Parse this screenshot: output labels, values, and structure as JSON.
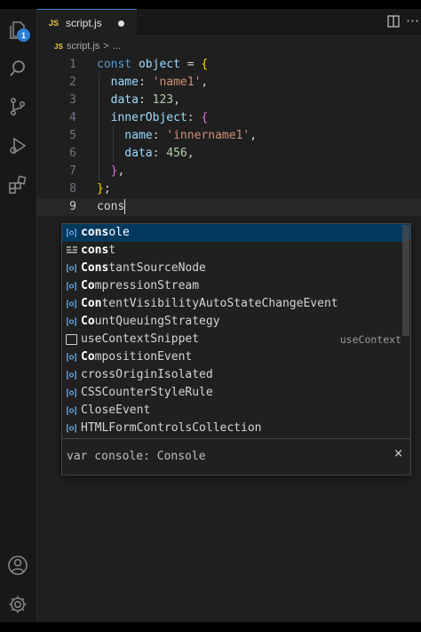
{
  "tab": {
    "badge": "JS",
    "title": "script.js"
  },
  "breadcrumb": {
    "badge": "JS",
    "file": "script.js",
    "separator": ">",
    "more": "..."
  },
  "activity": {
    "explorer_badge": "1"
  },
  "lines": [
    {
      "n": "1",
      "tokens": [
        {
          "t": "const ",
          "c": "kw"
        },
        {
          "t": "object",
          "c": "var"
        },
        {
          "t": " = ",
          "c": "punc"
        },
        {
          "t": "{",
          "c": "br2"
        }
      ]
    },
    {
      "n": "2",
      "tokens": [
        {
          "t": "  name",
          "c": "prop"
        },
        {
          "t": ": ",
          "c": "punc"
        },
        {
          "t": "'name1'",
          "c": "str"
        },
        {
          "t": ",",
          "c": "punc"
        }
      ]
    },
    {
      "n": "3",
      "tokens": [
        {
          "t": "  data",
          "c": "prop"
        },
        {
          "t": ": ",
          "c": "punc"
        },
        {
          "t": "123",
          "c": "num"
        },
        {
          "t": ",",
          "c": "punc"
        }
      ]
    },
    {
      "n": "4",
      "tokens": [
        {
          "t": "  innerObject",
          "c": "prop"
        },
        {
          "t": ": ",
          "c": "punc"
        },
        {
          "t": "{",
          "c": "br"
        }
      ]
    },
    {
      "n": "5",
      "tokens": [
        {
          "t": "    name",
          "c": "prop"
        },
        {
          "t": ": ",
          "c": "punc"
        },
        {
          "t": "'innername1'",
          "c": "str"
        },
        {
          "t": ",",
          "c": "punc"
        }
      ]
    },
    {
      "n": "6",
      "tokens": [
        {
          "t": "    data",
          "c": "prop"
        },
        {
          "t": ": ",
          "c": "punc"
        },
        {
          "t": "456",
          "c": "num"
        },
        {
          "t": ",",
          "c": "punc"
        }
      ]
    },
    {
      "n": "7",
      "tokens": [
        {
          "t": "  ",
          "c": "punc"
        },
        {
          "t": "}",
          "c": "br"
        },
        {
          "t": ",",
          "c": "punc"
        }
      ]
    },
    {
      "n": "8",
      "tokens": [
        {
          "t": "}",
          "c": "br2"
        },
        {
          "t": ";",
          "c": "punc"
        }
      ]
    },
    {
      "n": "9",
      "tokens": [
        {
          "t": "cons",
          "c": "punc"
        }
      ]
    }
  ],
  "suggestions": [
    {
      "match": "cons",
      "rest": "ole",
      "icon": "variable-icon",
      "detail": ""
    },
    {
      "match": "cons",
      "rest": "t",
      "icon": "keyword-icon",
      "detail": ""
    },
    {
      "match": "Cons",
      "rest": "tantSourceNode",
      "icon": "variable-icon",
      "detail": ""
    },
    {
      "match": "Co",
      "rest": "mpressionStream",
      "icon": "variable-icon",
      "detail": ""
    },
    {
      "match": "Con",
      "rest": "tentVisibilityAutoStateChangeEvent",
      "icon": "variable-icon",
      "detail": ""
    },
    {
      "match": "Co",
      "rest": "untQueuingStrategy",
      "icon": "variable-icon",
      "detail": ""
    },
    {
      "match": "",
      "rest": "useContextSnippet",
      "icon": "snippet-icon",
      "detail": "useContext"
    },
    {
      "match": "Co",
      "rest": "mpositionEvent",
      "icon": "variable-icon",
      "detail": ""
    },
    {
      "match": "",
      "rest": "crossOriginIsolated",
      "icon": "variable-icon",
      "detail": ""
    },
    {
      "match": "",
      "rest": "CSSCounterStyleRule",
      "icon": "variable-icon",
      "detail": ""
    },
    {
      "match": "",
      "rest": "CloseEvent",
      "icon": "variable-icon",
      "detail": ""
    },
    {
      "match": "",
      "rest": "HTMLFormControlsCollection",
      "icon": "variable-icon",
      "detail": ""
    }
  ],
  "details": {
    "text": "var console: Console",
    "close": "×"
  },
  "colors": {
    "accent": "#3a85d6",
    "selection": "#04395e",
    "string": "#ce9178",
    "number": "#b5cea8",
    "keyword": "#569cd6"
  }
}
